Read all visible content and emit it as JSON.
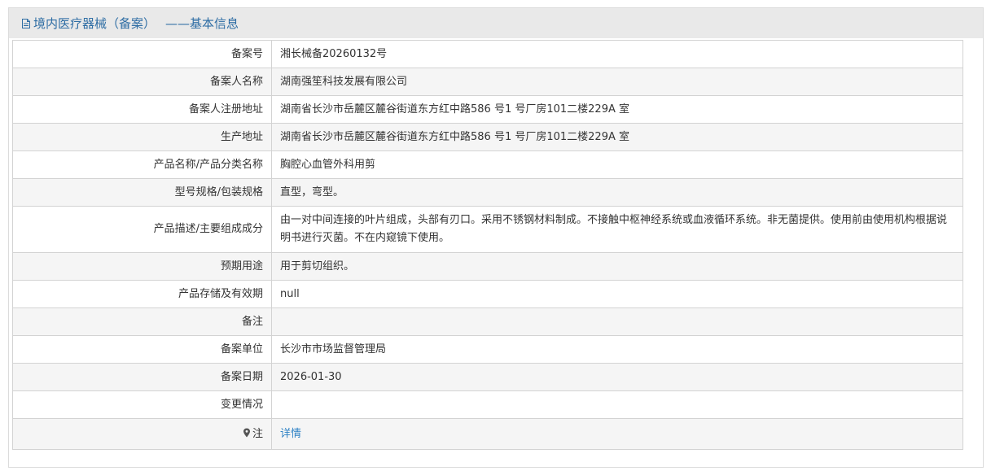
{
  "header": {
    "title": "境内医疗器械（备案）",
    "subtitle": "——基本信息"
  },
  "rows": [
    {
      "label": "备案号",
      "value": "湘长械备20260132号"
    },
    {
      "label": "备案人名称",
      "value": "湖南强笙科技发展有限公司"
    },
    {
      "label": "备案人注册地址",
      "value": "湖南省长沙市岳麓区麓谷街道东方红中路586 号1 号厂房101二楼229A 室"
    },
    {
      "label": "生产地址",
      "value": "湖南省长沙市岳麓区麓谷街道东方红中路586 号1 号厂房101二楼229A 室"
    },
    {
      "label": "产品名称/产品分类名称",
      "value": "胸腔心血管外科用剪"
    },
    {
      "label": "型号规格/包装规格",
      "value": "直型，弯型。"
    },
    {
      "label": "产品描述/主要组成成分",
      "value": "由一对中间连接的叶片组成，头部有刃口。采用不锈钢材料制成。不接触中枢神经系统或血液循环系统。非无菌提供。使用前由使用机构根据说明书进行灭菌。不在内窥镜下使用。"
    },
    {
      "label": "预期用途",
      "value": "用于剪切组织。"
    },
    {
      "label": "产品存储及有效期",
      "value": "null"
    },
    {
      "label": "备注",
      "value": ""
    },
    {
      "label": "备案单位",
      "value": "长沙市市场监督管理局"
    },
    {
      "label": "备案日期",
      "value": "2026-01-30"
    },
    {
      "label": "变更情况",
      "value": ""
    }
  ],
  "note": {
    "label": "注",
    "link": "详情"
  },
  "colors": {
    "header_text": "#2e6da4",
    "link": "#2e82c5",
    "header_bg": "#e9e9e9",
    "row_alt_bg": "#f5f5f5"
  }
}
